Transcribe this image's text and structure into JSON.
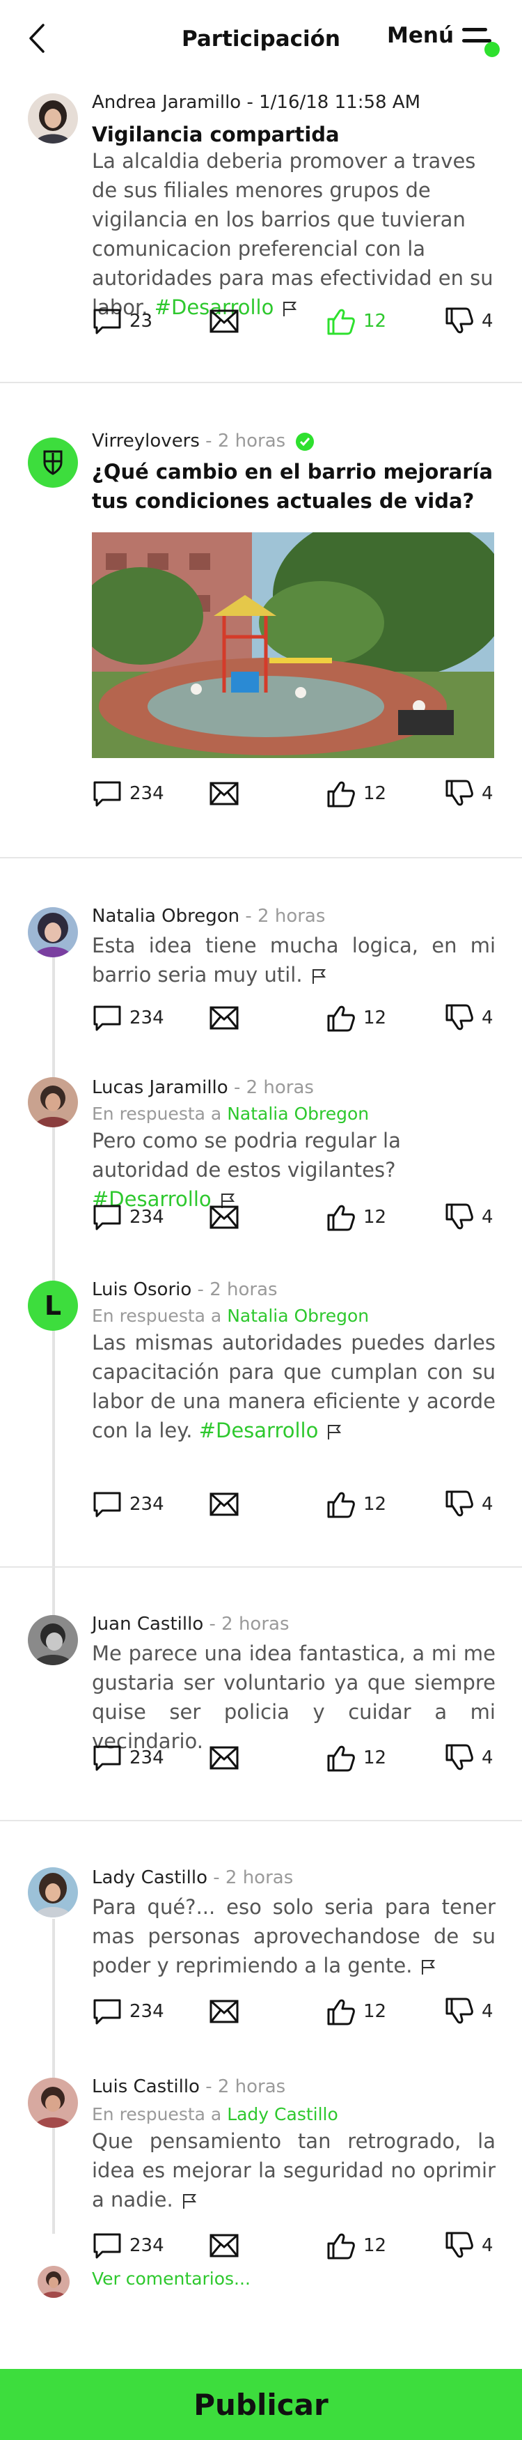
{
  "header": {
    "title": "Participación",
    "menu_label": "Menú",
    "back_icon": "chevron-left-icon",
    "menu_icon": "hamburger-menu-icon",
    "accent_color": "#3ddd3d"
  },
  "posts": [
    {
      "author_line": "Andrea Jaramillo - 1/16/18 11:58 AM",
      "title": "Vigilancia compartida",
      "body": "La alcaldia deberia promover a traves de sus filiales menores grupos de vigilancia en los barrios que tuvieran comunicacion preferencial con la autoridades para mas efectividad en su labor.",
      "tag": "#Desarrollo",
      "comments": "23",
      "likes": "12",
      "dislikes": "4",
      "liked": true
    },
    {
      "author": "Virreylovers",
      "time": " - 2 horas",
      "verified_icon": "verified-check-icon",
      "title": "¿Qué cambio en el barrio mejoraría tus condiciones actuales de vida?",
      "image": "playground-photo",
      "comments": "234",
      "likes": "12",
      "dislikes": "4"
    }
  ],
  "comments": [
    {
      "author": "Natalia Obregon",
      "time": " - 2 horas",
      "body": "Esta idea tiene mucha logica, en mi barrio seria muy util.",
      "comments": "234",
      "likes": "12",
      "dislikes": "4"
    },
    {
      "author": "Lucas Jaramillo",
      "time": " - 2 horas",
      "reply_prefix": "En respuesta a ",
      "reply_to": "Natalia Obregon",
      "body": "Pero como se podria regular la autoridad de estos vigilantes?",
      "tag": "#Desarrollo",
      "comments": "234",
      "likes": "12",
      "dislikes": "4"
    },
    {
      "author": "Luis Osorio",
      "initial": "L",
      "time": " - 2 horas",
      "reply_prefix": "En respuesta a ",
      "reply_to": "Natalia Obregon",
      "body": "Las mismas autoridades puedes darles capacitación para que cumplan con su labor de una manera eficiente y acorde con la ley.",
      "tag": "#Desarrollo",
      "comments": "234",
      "likes": "12",
      "dislikes": "4"
    },
    {
      "author": "Juan Castillo",
      "time": " - 2 horas",
      "body": "Me parece una idea fantastica, a mi me gustaria ser voluntario ya que siempre quise ser policia y cuidar a mi vecindario.",
      "comments": "234",
      "likes": "12",
      "dislikes": "4"
    },
    {
      "author": "Lady Castillo",
      "time": " - 2 horas",
      "body": "Para qué?... eso solo seria para tener mas personas aprovechandose de su poder y reprimiendo a la gente.",
      "comments": "234",
      "likes": "12",
      "dislikes": "4"
    },
    {
      "author": "Luis Castillo",
      "time": " - 2 horas",
      "reply_prefix": "En respuesta a ",
      "reply_to": "Lady Castillo",
      "body": "Que pensamiento tan retrogrado, la idea es mejorar la seguridad no oprimir a nadie.",
      "comments": "234",
      "likes": "12",
      "dislikes": "4"
    }
  ],
  "see_more": "Ver comentarios...",
  "publish_label": "Publicar"
}
